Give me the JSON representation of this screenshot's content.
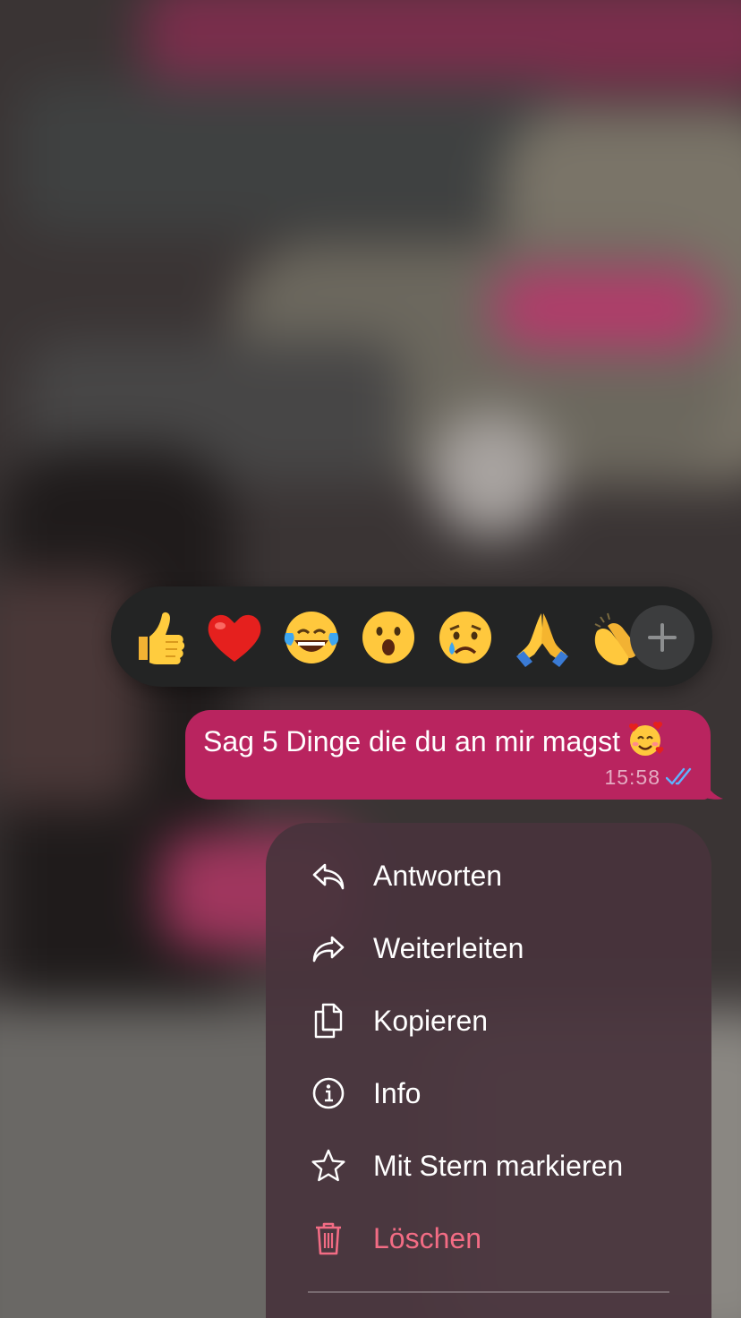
{
  "reactions": {
    "emojis": [
      {
        "name": "thumbs-up",
        "char": "👍"
      },
      {
        "name": "red-heart",
        "char": "❤️"
      },
      {
        "name": "face-with-tears-of-joy",
        "char": "😂"
      },
      {
        "name": "face-with-open-mouth",
        "char": "😮"
      },
      {
        "name": "crying-face",
        "char": "😢"
      },
      {
        "name": "folded-hands",
        "char": "🙏"
      },
      {
        "name": "clapping-hands",
        "char": "👏"
      }
    ],
    "more_icon": "plus-icon"
  },
  "message": {
    "text": "Sag 5 Dinge die du an mir magst",
    "emoji": "🥰",
    "time": "15:58",
    "status_icon": "double-check-read-icon",
    "bubble_color": "#b9245f"
  },
  "menu": {
    "items": [
      {
        "label": "Antworten",
        "icon": "reply-icon"
      },
      {
        "label": "Weiterleiten",
        "icon": "forward-icon"
      },
      {
        "label": "Kopieren",
        "icon": "copy-icon"
      },
      {
        "label": "Info",
        "icon": "info-icon"
      },
      {
        "label": "Mit Stern markieren",
        "icon": "star-icon"
      },
      {
        "label": "Löschen",
        "icon": "trash-icon",
        "color": "#f26c84"
      }
    ]
  }
}
